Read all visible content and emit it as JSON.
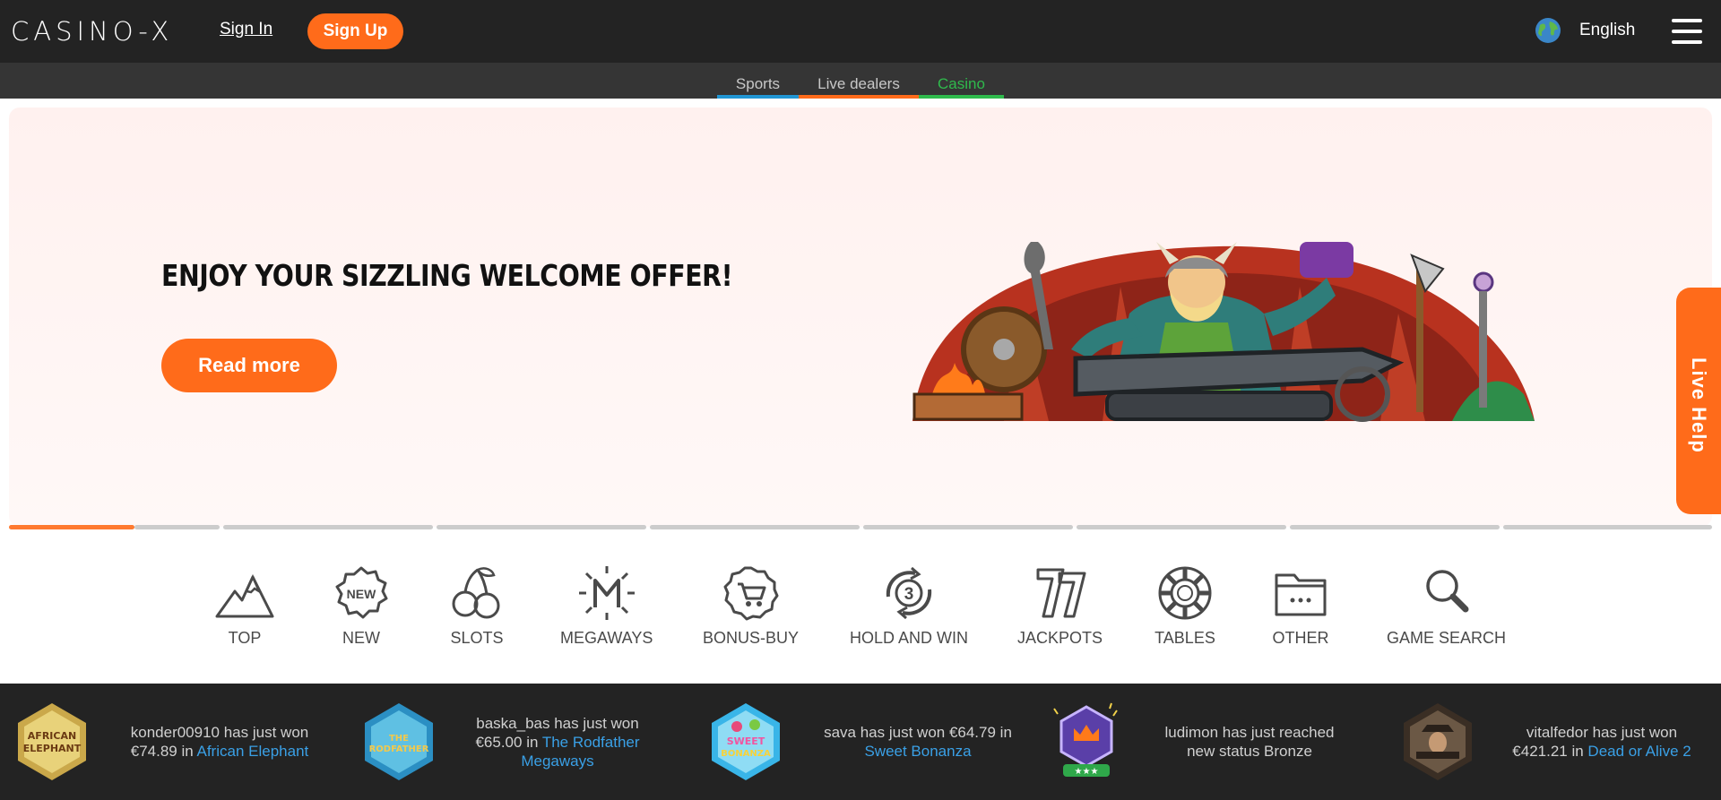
{
  "header": {
    "logo": "CASINO-X",
    "signin_label": "Sign In",
    "signup_label": "Sign Up",
    "language": "English"
  },
  "subnav": {
    "tabs": [
      {
        "label": "Sports",
        "color": "#2196d3"
      },
      {
        "label": "Live dealers",
        "color": "#ff6b1a"
      },
      {
        "label": "Casino",
        "color": "#2fba4c",
        "active": true
      }
    ]
  },
  "banner": {
    "headline": "ENJOY YOUR SIZZLING WELCOME OFFER!",
    "cta_label": "Read more",
    "slides_total": 8,
    "active_slide": 1
  },
  "live_help": {
    "label": "Live Help"
  },
  "categories": [
    {
      "label": "TOP",
      "icon": "mountain-icon"
    },
    {
      "label": "NEW",
      "icon": "new-badge-icon"
    },
    {
      "label": "SLOTS",
      "icon": "cherries-icon"
    },
    {
      "label": "MEGAWAYS",
      "icon": "megaways-icon"
    },
    {
      "label": "BONUS-BUY",
      "icon": "cart-badge-icon"
    },
    {
      "label": "HOLD AND WIN",
      "icon": "hold-and-win-icon"
    },
    {
      "label": "JACKPOTS",
      "icon": "lucky-seven-icon"
    },
    {
      "label": "TABLES",
      "icon": "poker-chip-icon"
    },
    {
      "label": "OTHER",
      "icon": "folder-icon"
    },
    {
      "label": "GAME SEARCH",
      "icon": "search-icon"
    }
  ],
  "ticker": [
    {
      "pre": "konder00910 has just won",
      "line2": "€74.89 in",
      "game": "African Elephant",
      "thumb": "african-elephant"
    },
    {
      "pre": "baska_bas has just won",
      "line2": "€65.00 in",
      "game": "The Rodfather",
      "game2": "Megaways",
      "thumb": "rodfather"
    },
    {
      "pre": "sava has just won €64.79 in",
      "line2": "",
      "game": "Sweet Bonanza",
      "thumb": "sweet-bonanza"
    },
    {
      "pre": "ludimon has just reached",
      "line2": "new status Bronze",
      "game": "",
      "thumb": "bronze-status"
    },
    {
      "pre": "vitalfedor has just won",
      "line2": "€421.21 in",
      "game": "Dead or Alive 2",
      "thumb": "dead-or-alive"
    }
  ],
  "colors": {
    "accent": "#ff6b1a",
    "link": "#3aa0e6",
    "header_bg": "#232323"
  }
}
